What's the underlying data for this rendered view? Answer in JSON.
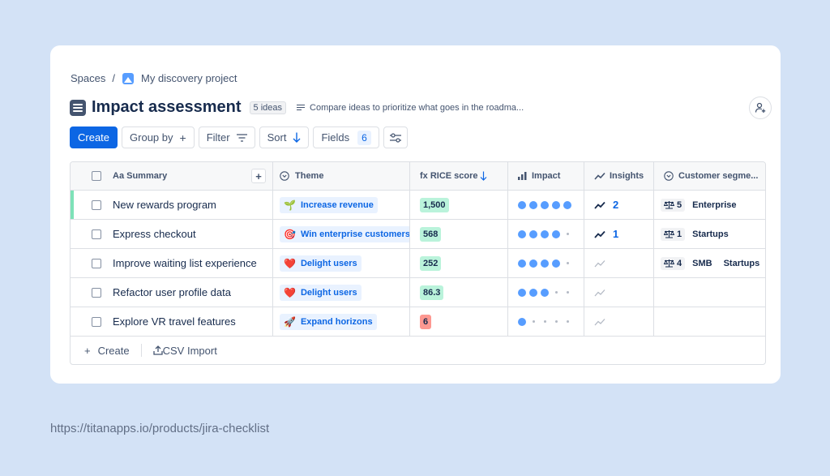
{
  "breadcrumb": {
    "root": "Spaces",
    "separator": "/",
    "project": "My discovery project"
  },
  "header": {
    "title": "Impact assessment",
    "badge": "5 ideas",
    "description": "Compare ideas to prioritize what goes in the roadma..."
  },
  "toolbar": {
    "create": "Create",
    "group_by": "Group by",
    "filter": "Filter",
    "sort": "Sort",
    "fields": "Fields",
    "fields_count": "6"
  },
  "columns": {
    "summary": "Aa Summary",
    "theme": "Theme",
    "rice": "fx RICE score",
    "impact": "Impact",
    "insights": "Insights",
    "segment": "Customer segme..."
  },
  "rows": [
    {
      "summary": "New rewards program",
      "theme_icon": "🌱",
      "theme": "Increase revenue",
      "rice": "1,500",
      "rice_color": "#baf3db",
      "impact": 5,
      "insights": "2",
      "seg_count": "5",
      "segments": [
        "Enterprise"
      ]
    },
    {
      "summary": "Express checkout",
      "theme_icon": "🎯",
      "theme": "Win enterprise customers",
      "rice": "568",
      "rice_color": "#baf3db",
      "impact": 4,
      "insights": "1",
      "seg_count": "1",
      "segments": [
        "Startups"
      ]
    },
    {
      "summary": "Improve waiting list experience",
      "theme_icon": "❤️",
      "theme": "Delight users",
      "rice": "252",
      "rice_color": "#baf3db",
      "impact": 4,
      "insights": "",
      "seg_count": "4",
      "segments": [
        "SMB",
        "Startups"
      ]
    },
    {
      "summary": "Refactor user profile data",
      "theme_icon": "❤️",
      "theme": "Delight users",
      "rice": "86.3",
      "rice_color": "#baf3db",
      "impact": 3,
      "insights": "",
      "seg_count": "",
      "segments": []
    },
    {
      "summary": "Explore VR travel features",
      "theme_icon": "🚀",
      "theme": "Expand horizons",
      "rice": "6",
      "rice_color": "#fd9891",
      "impact": 1,
      "insights": "",
      "seg_count": "",
      "segments": []
    }
  ],
  "footer": {
    "create": "Create",
    "csv_import": "CSV Import"
  },
  "url": "https://titanapps.io/products/jira-checklist"
}
